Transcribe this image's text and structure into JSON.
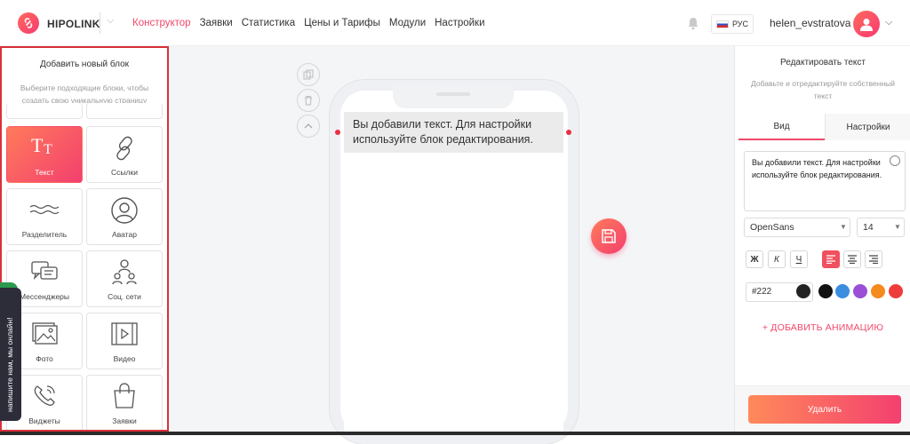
{
  "brand": {
    "name": "HIPOLINK",
    "accent": "#f2486a"
  },
  "nav": {
    "items": [
      "Конструктор",
      "Заявки",
      "Статистика",
      "Цены и Тарифы",
      "Модули",
      "Настройки"
    ],
    "active": "Конструктор"
  },
  "header": {
    "lang": "РУС",
    "username": "helen_evstratova",
    "bell_icon": "bell-icon"
  },
  "left_panel": {
    "title": "Добавить новый блок",
    "subtitle": "Выберите подходящие блоки, чтобы создать свою уникальную страницу",
    "blocks": [
      {
        "label": "Текст",
        "icon": "text-icon",
        "active": true
      },
      {
        "label": "Ссылки",
        "icon": "link-icon"
      },
      {
        "label": "Разделитель",
        "icon": "divider-icon"
      },
      {
        "label": "Аватар",
        "icon": "avatar-icon"
      },
      {
        "label": "Мессенджеры",
        "icon": "messengers-icon"
      },
      {
        "label": "Соц. сети",
        "icon": "social-icon"
      },
      {
        "label": "Фото",
        "icon": "photo-icon"
      },
      {
        "label": "Видео",
        "icon": "video-icon"
      },
      {
        "label": "Виджеты",
        "icon": "widgets-icon"
      },
      {
        "label": "Заявки",
        "icon": "orders-icon"
      }
    ],
    "chat_tab": "напишите нам, мы онлайн!"
  },
  "preview": {
    "text_block": "Вы добавили текст. Для настройки используйте блок редактирования."
  },
  "right_panel": {
    "title": "Редактировать текст",
    "subtitle": "Добавьте и отредактируйте собственный текст",
    "tabs": [
      "Вид",
      "Настройки"
    ],
    "active_tab": "Вид",
    "text_value": "Вы добавили текст. Для настройки используйте блок редактирования.",
    "font": "OpenSans",
    "size": "14",
    "format_buttons": {
      "bold": "Ж",
      "italic": "К",
      "underline": "Ч"
    },
    "align": "left",
    "color_value": "#222",
    "swatches": [
      "#222222",
      "#111111",
      "#3b8de0",
      "#9b4fd6",
      "#f58a1f",
      "#ee3c3c"
    ],
    "add_animation": "+ ДОБАВИТЬ АНИМАЦИЮ",
    "delete_label": "Удалить"
  }
}
